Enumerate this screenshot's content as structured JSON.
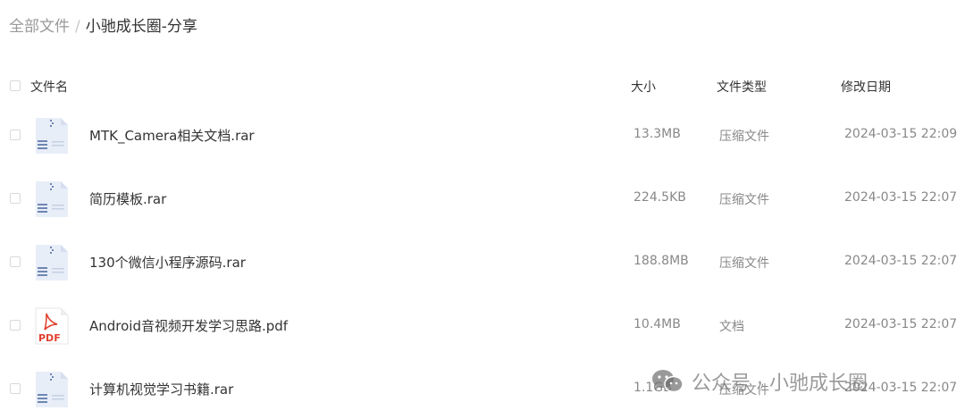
{
  "breadcrumb": {
    "root": "全部文件",
    "separator": "/",
    "current": "小驰成长圈-分享"
  },
  "table": {
    "headers": {
      "name": "文件名",
      "size": "大小",
      "type": "文件类型",
      "modified": "修改日期"
    },
    "rows": [
      {
        "icon": "archive-file-icon",
        "name": "MTK_Camera相关文档.rar",
        "size": "13.3MB",
        "type": "压缩文件",
        "modified": "2024-03-15 22:09"
      },
      {
        "icon": "archive-file-icon",
        "name": "简历模板.rar",
        "size": "224.5KB",
        "type": "压缩文件",
        "modified": "2024-03-15 22:07"
      },
      {
        "icon": "archive-file-icon",
        "name": "130个微信小程序源码.rar",
        "size": "188.8MB",
        "type": "压缩文件",
        "modified": "2024-03-15 22:07"
      },
      {
        "icon": "pdf-file-icon",
        "icon_label": "PDF",
        "name": "Android音视频开发学习思路.pdf",
        "size": "10.4MB",
        "type": "文档",
        "modified": "2024-03-15 22:07"
      },
      {
        "icon": "archive-file-icon",
        "name": "计算机视觉学习书籍.rar",
        "size": "1.1GB",
        "type": "压缩文件",
        "modified": "2024-03-15 22:07"
      }
    ]
  },
  "watermark": {
    "icon": "wechat-icon",
    "text": "公众号 · 小驰成长圈"
  },
  "colors": {
    "archive_icon_body": "#e8eef8",
    "archive_icon_accent": "#6f86b3",
    "pdf_accent": "#e0412f",
    "muted_text": "#888888"
  }
}
